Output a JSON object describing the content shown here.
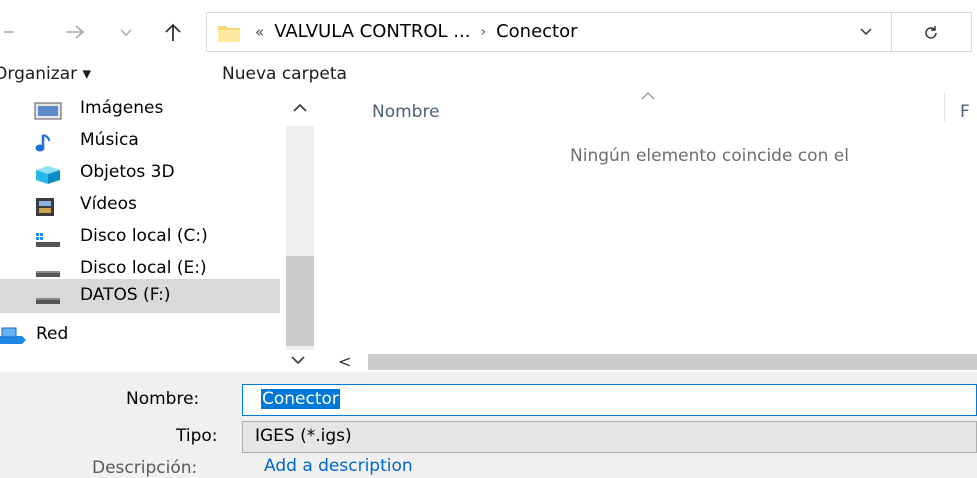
{
  "address": {
    "crumb_prefix": "«",
    "crumbs": [
      "VALVULA CONTROL ...",
      "Conector"
    ],
    "separator": "›"
  },
  "toolbar": {
    "organize_label": "Organizar ▾",
    "new_folder_label": "Nueva carpeta"
  },
  "nav_pane": {
    "items": [
      {
        "label": "Imágenes",
        "icon": "pictures-icon"
      },
      {
        "label": "Música",
        "icon": "music-icon"
      },
      {
        "label": "Objetos 3D",
        "icon": "3d-objects-icon"
      },
      {
        "label": "Vídeos",
        "icon": "videos-icon"
      },
      {
        "label": "Disco local (C:)",
        "icon": "windows-drive-icon"
      },
      {
        "label": "Disco local (E:)",
        "icon": "drive-icon"
      },
      {
        "label": "DATOS (F:)",
        "icon": "drive-icon",
        "selected": true
      },
      {
        "label": "Red",
        "icon": "network-icon"
      }
    ]
  },
  "file_list": {
    "columns": [
      "Nombre",
      "F"
    ],
    "empty_message": "Ningún elemento coincide con el"
  },
  "form": {
    "name_label": "Nombre:",
    "name_value": "Conector",
    "type_label": "Tipo:",
    "type_value": "IGES (*.igs)",
    "description_label": "Descripción:",
    "description_link": "Add a description"
  },
  "colors": {
    "accent": "#0078d7",
    "selection_bg": "#d9d9d9",
    "footer_bg": "#f0f0f0",
    "link": "#0066cc"
  }
}
